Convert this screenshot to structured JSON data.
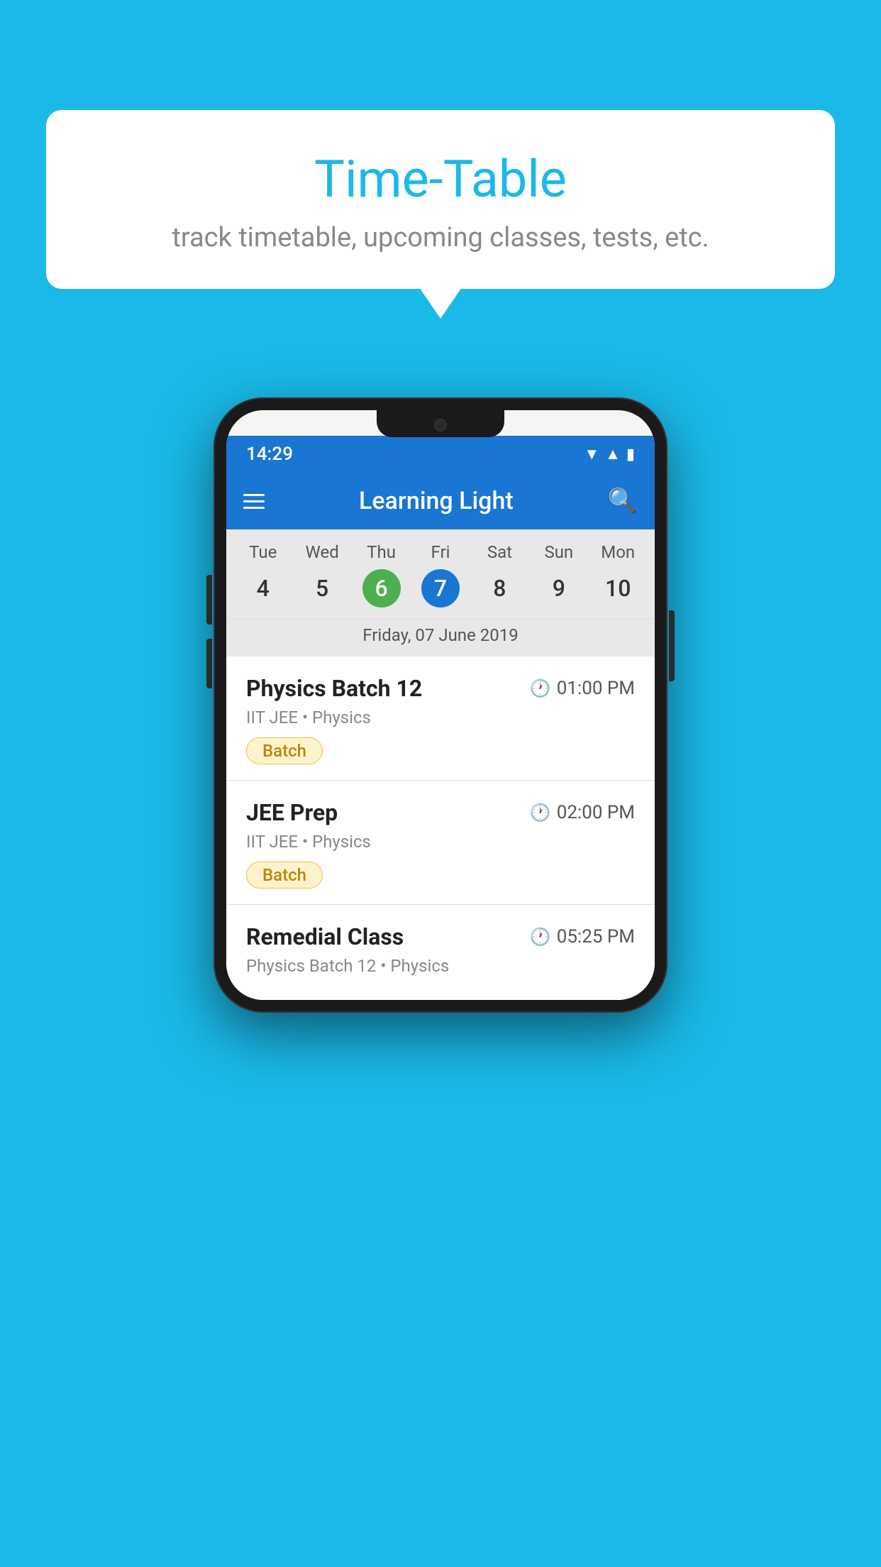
{
  "background_color": "#1ab9e8",
  "bubble": {
    "title": "Time-Table",
    "subtitle": "track timetable, upcoming classes, tests, etc."
  },
  "phone": {
    "status_bar": {
      "time": "14:29",
      "wifi": "▾",
      "signal": "▲",
      "battery": "▮"
    },
    "header": {
      "app_name": "Learning Light",
      "hamburger_label": "menu",
      "search_label": "search"
    },
    "calendar": {
      "days": [
        {
          "name": "Tue",
          "num": "4",
          "state": "normal"
        },
        {
          "name": "Wed",
          "num": "5",
          "state": "normal"
        },
        {
          "name": "Thu",
          "num": "6",
          "state": "today"
        },
        {
          "name": "Fri",
          "num": "7",
          "state": "selected"
        },
        {
          "name": "Sat",
          "num": "8",
          "state": "normal"
        },
        {
          "name": "Sun",
          "num": "9",
          "state": "normal"
        },
        {
          "name": "Mon",
          "num": "10",
          "state": "normal"
        }
      ],
      "selected_date_label": "Friday, 07 June 2019"
    },
    "schedule": [
      {
        "title": "Physics Batch 12",
        "time": "01:00 PM",
        "subtitle": "IIT JEE • Physics",
        "badge": "Batch"
      },
      {
        "title": "JEE Prep",
        "time": "02:00 PM",
        "subtitle": "IIT JEE • Physics",
        "badge": "Batch"
      },
      {
        "title": "Remedial Class",
        "time": "05:25 PM",
        "subtitle": "Physics Batch 12 • Physics",
        "badge": null
      }
    ]
  }
}
